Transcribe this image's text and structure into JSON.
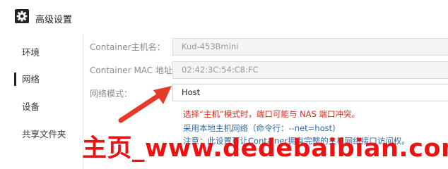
{
  "window": {
    "title": "高级设置",
    "icon": "gear-icon"
  },
  "sidebar": {
    "items": [
      {
        "label": "环境"
      },
      {
        "label": "网络",
        "active": true
      },
      {
        "label": "设备"
      },
      {
        "label": "共享文件夹"
      }
    ]
  },
  "network": {
    "hostname": {
      "label": "Container主机名：",
      "value": "Kud-453Bmini"
    },
    "mac": {
      "label": "Container MAC 地址：",
      "value": "02:42:3C:54:C8:FC"
    },
    "mode": {
      "label": "网络模式：",
      "value": "Host"
    },
    "notes": {
      "warning": "选择“主机”模式时，端口可能与 NAS 端口冲突。",
      "hint": "采用本地主机网络（命令行：--net=host)",
      "notice": "注意：此设置可让Container拥有完整的主机网络接口访问权。"
    }
  },
  "watermark": {
    "text": "主页_www.dedebaibian.com"
  },
  "colors": {
    "warning": "#d62a1e",
    "hint": "#2f6aa6",
    "arrow": "#e53a2a",
    "watermark": "#ee1111"
  }
}
